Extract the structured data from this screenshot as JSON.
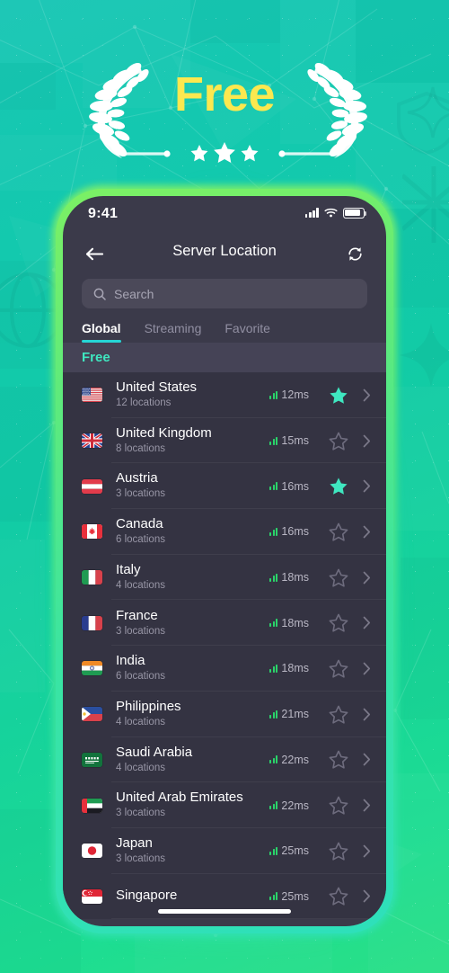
{
  "hero": {
    "title": "Free",
    "title_color": "#fbe84f",
    "stars": 3,
    "wreath_icon": "laurel-wreath-icon"
  },
  "phone": {
    "frame_color": "#5eea7c",
    "screen_bg": "#3b3a4a"
  },
  "statusbar": {
    "time": "9:41",
    "icons": [
      "cellular-signal-icon",
      "wifi-icon",
      "battery-icon"
    ]
  },
  "navbar": {
    "back_icon": "arrow-left-icon",
    "title": "Server Location",
    "refresh_icon": "refresh-icon"
  },
  "search": {
    "icon": "search-icon",
    "placeholder": "Search",
    "value": ""
  },
  "tabs": [
    {
      "label": "Global",
      "active": true
    },
    {
      "label": "Streaming",
      "active": false
    },
    {
      "label": "Favorite",
      "active": false
    }
  ],
  "section": {
    "label": "Free",
    "label_color": "#3fe7c0"
  },
  "colors": {
    "accent_cyan": "#25d6d6",
    "star_active": "#3fe7c0",
    "ping_bars": "#2ad46a",
    "row_bg": "#343342",
    "section_bg": "#454356"
  },
  "servers": [
    {
      "country": "United States",
      "locations": "12 locations",
      "ping": "12ms",
      "bars": 3,
      "favorite": true,
      "flag": "flag-us"
    },
    {
      "country": "United Kingdom",
      "locations": "8 locations",
      "ping": "15ms",
      "bars": 3,
      "favorite": false,
      "flag": "flag-gb"
    },
    {
      "country": "Austria",
      "locations": "3 locations",
      "ping": "16ms",
      "bars": 3,
      "favorite": true,
      "flag": "flag-at"
    },
    {
      "country": "Canada",
      "locations": "6 locations",
      "ping": "16ms",
      "bars": 3,
      "favorite": false,
      "flag": "flag-ca"
    },
    {
      "country": "Italy",
      "locations": "4 locations",
      "ping": "18ms",
      "bars": 3,
      "favorite": false,
      "flag": "flag-it"
    },
    {
      "country": "France",
      "locations": "3 locations",
      "ping": "18ms",
      "bars": 3,
      "favorite": false,
      "flag": "flag-fr"
    },
    {
      "country": "India",
      "locations": "6 locations",
      "ping": "18ms",
      "bars": 3,
      "favorite": false,
      "flag": "flag-in"
    },
    {
      "country": "Philippines",
      "locations": "4 locations",
      "ping": "21ms",
      "bars": 3,
      "favorite": false,
      "flag": "flag-ph"
    },
    {
      "country": "Saudi Arabia",
      "locations": "4 locations",
      "ping": "22ms",
      "bars": 3,
      "favorite": false,
      "flag": "flag-sa"
    },
    {
      "country": "United Arab Emirates",
      "locations": "3 locations",
      "ping": "22ms",
      "bars": 3,
      "favorite": false,
      "flag": "flag-ae"
    },
    {
      "country": "Japan",
      "locations": "3 locations",
      "ping": "25ms",
      "bars": 3,
      "favorite": false,
      "flag": "flag-jp"
    },
    {
      "country": "Singapore",
      "locations": "",
      "ping": "25ms",
      "bars": 3,
      "favorite": false,
      "flag": "flag-sg"
    }
  ],
  "home_indicator": "home-indicator"
}
